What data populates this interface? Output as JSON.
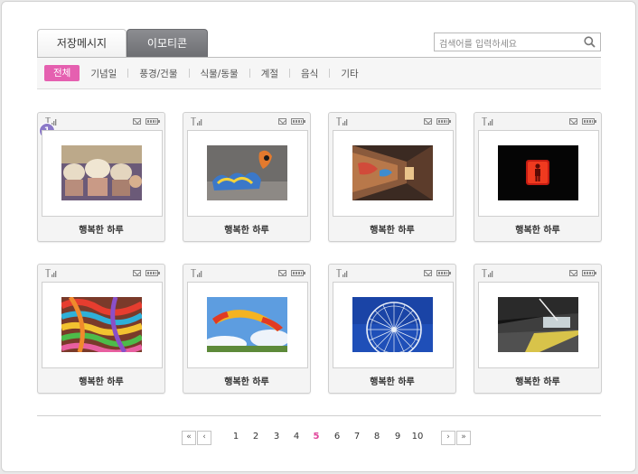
{
  "tabs": [
    {
      "label": "저장메시지",
      "active": false
    },
    {
      "label": "이모티콘",
      "active": true
    }
  ],
  "search": {
    "placeholder": "검색어를 입력하세요"
  },
  "categories": [
    {
      "label": "전체",
      "active": true
    },
    {
      "label": "기념일"
    },
    {
      "label": "풍경/건물"
    },
    {
      "label": "식물/동물"
    },
    {
      "label": "계절"
    },
    {
      "label": "음식"
    },
    {
      "label": "기타"
    }
  ],
  "cards": [
    {
      "caption": "행복한 하루",
      "badge": "1",
      "image": "cupcakes"
    },
    {
      "caption": "행복한 하루",
      "image": "graffiti-wall"
    },
    {
      "caption": "행복한 하루",
      "image": "graffiti-tunnel"
    },
    {
      "caption": "행복한 하루",
      "image": "red-pedestrian-signal"
    },
    {
      "caption": "행복한 하루",
      "image": "colorful-yarn"
    },
    {
      "caption": "행복한 하루",
      "image": "paraglider-sky"
    },
    {
      "caption": "행복한 하루",
      "image": "ferris-wheel"
    },
    {
      "caption": "행복한 하루",
      "image": "train-station"
    }
  ],
  "pagination": {
    "first": "«",
    "prev": "‹",
    "next": "›",
    "last": "»",
    "pages": [
      "1",
      "2",
      "3",
      "4",
      "5",
      "6",
      "7",
      "8",
      "9",
      "10"
    ],
    "current": "5"
  },
  "colors": {
    "accent": "#e560b0",
    "current_page": "#e0449b",
    "badge": "#8b79c8"
  }
}
